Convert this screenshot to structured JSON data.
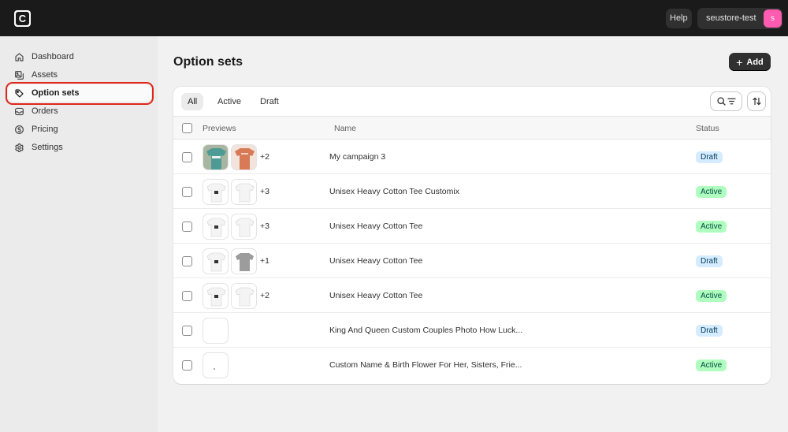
{
  "topbar": {
    "logo_letter": "C",
    "help_label": "Help",
    "store_name": "seustore-test",
    "store_initial": "s"
  },
  "sidebar": {
    "items": [
      {
        "label": "Dashboard",
        "icon": "home-icon"
      },
      {
        "label": "Assets",
        "icon": "images-icon"
      },
      {
        "label": "Option sets",
        "icon": "tag-icon",
        "selected": true
      },
      {
        "label": "Orders",
        "icon": "inbox-icon"
      },
      {
        "label": "Pricing",
        "icon": "dollar-icon"
      },
      {
        "label": "Settings",
        "icon": "gear-icon"
      }
    ]
  },
  "page": {
    "title": "Option sets",
    "add_label": "Add"
  },
  "tabs": [
    {
      "label": "All",
      "active": true
    },
    {
      "label": "Active",
      "active": false
    },
    {
      "label": "Draft",
      "active": false
    }
  ],
  "table": {
    "headers": {
      "previews": "Previews",
      "name": "Name",
      "status": "Status"
    },
    "rows": [
      {
        "more": "+2",
        "name": "My campaign 3",
        "status": "Draft",
        "thumbs": [
          "teal-shirt",
          "orange-shirt"
        ]
      },
      {
        "more": "+3",
        "name": "Unisex Heavy Cotton Tee Customix",
        "status": "Active",
        "thumbs": [
          "white-shirt-print",
          "white-shirt"
        ]
      },
      {
        "more": "+3",
        "name": "Unisex Heavy Cotton Tee",
        "status": "Active",
        "thumbs": [
          "white-shirt-print",
          "white-shirt"
        ]
      },
      {
        "more": "+1",
        "name": "Unisex Heavy Cotton Tee",
        "status": "Draft",
        "thumbs": [
          "white-shirt-print",
          "gray-shirt"
        ]
      },
      {
        "more": "+2",
        "name": "Unisex Heavy Cotton Tee",
        "status": "Active",
        "thumbs": [
          "white-shirt-print",
          "white-shirt"
        ]
      },
      {
        "more": "",
        "name": "King And Queen Custom Couples Photo How Luck...",
        "status": "Draft",
        "thumbs": [
          "blank"
        ]
      },
      {
        "more": "",
        "name": "Custom Name & Birth Flower For Her, Sisters, Frie...",
        "status": "Active",
        "thumbs": [
          "blank-dot"
        ]
      }
    ]
  },
  "colors": {
    "topbar": "#1a1a1a",
    "draft_badge": "#d5ebff",
    "active_badge": "#affebf",
    "selection_outline": "#e0261a"
  }
}
